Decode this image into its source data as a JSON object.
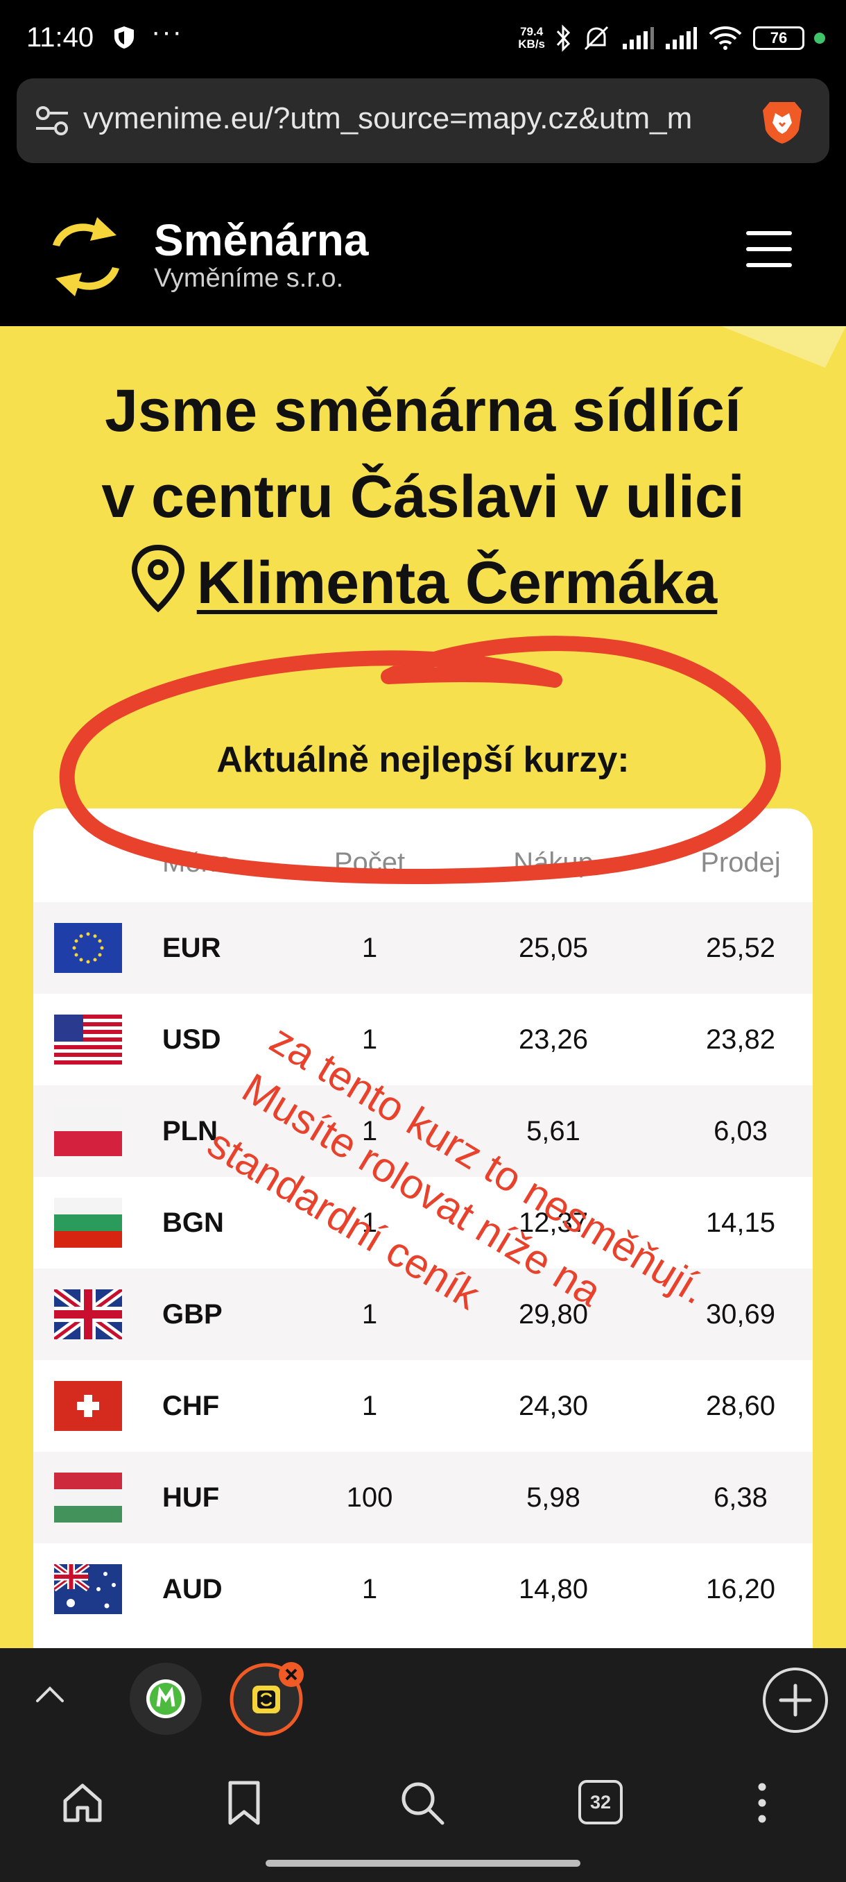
{
  "status_bar": {
    "time": "11:40",
    "more": "···",
    "net_speed_value": "79.4",
    "net_speed_unit": "KB/s",
    "battery": "76",
    "icons": [
      "shield-icon",
      "bluetooth-icon",
      "mute-icon",
      "signal-icon",
      "signal-icon",
      "wifi-icon",
      "battery-icon"
    ]
  },
  "browser": {
    "url": "vymenime.eu/?utm_source=mapy.cz&utm_m",
    "tab_count": "32",
    "accent": "#f05a24"
  },
  "site": {
    "brand_name": "Směnárna",
    "brand_sub": "Vyměníme s.r.o.",
    "heading_line1": "Jsme směnárna sídlící",
    "heading_line2": "v centru Čáslavi v ulici",
    "heading_address": "Klimenta Čermáka",
    "best_rates_title": "Aktuálně nejlepší kurzy:",
    "bg_color": "#f6e04e"
  },
  "table": {
    "headers": {
      "currency": "Měna",
      "count": "Počet",
      "buy": "Nákup",
      "sell": "Prodej"
    },
    "rows": [
      {
        "flag": "eu-flag-icon",
        "code": "EUR",
        "count": "1",
        "buy": "25,05",
        "sell": "25,52"
      },
      {
        "flag": "us-flag-icon",
        "code": "USD",
        "count": "1",
        "buy": "23,26",
        "sell": "23,82"
      },
      {
        "flag": "pl-flag-icon",
        "code": "PLN",
        "count": "1",
        "buy": "5,61",
        "sell": "6,03"
      },
      {
        "flag": "bg-flag-icon",
        "code": "BGN",
        "count": "1",
        "buy": "12,37",
        "sell": "14,15"
      },
      {
        "flag": "gb-flag-icon",
        "code": "GBP",
        "count": "1",
        "buy": "29,80",
        "sell": "30,69"
      },
      {
        "flag": "ch-flag-icon",
        "code": "CHF",
        "count": "1",
        "buy": "24,30",
        "sell": "28,60"
      },
      {
        "flag": "hu-flag-icon",
        "code": "HUF",
        "count": "100",
        "buy": "5,98",
        "sell": "6,38"
      },
      {
        "flag": "au-flag-icon",
        "code": "AUD",
        "count": "1",
        "buy": "14,80",
        "sell": "16,20"
      }
    ]
  },
  "annotation": {
    "line1": "za tento kurz to nesměňují.",
    "line2": "Musíte rolovat níže na",
    "line3": "standardní ceník",
    "color": "#e8412c"
  }
}
